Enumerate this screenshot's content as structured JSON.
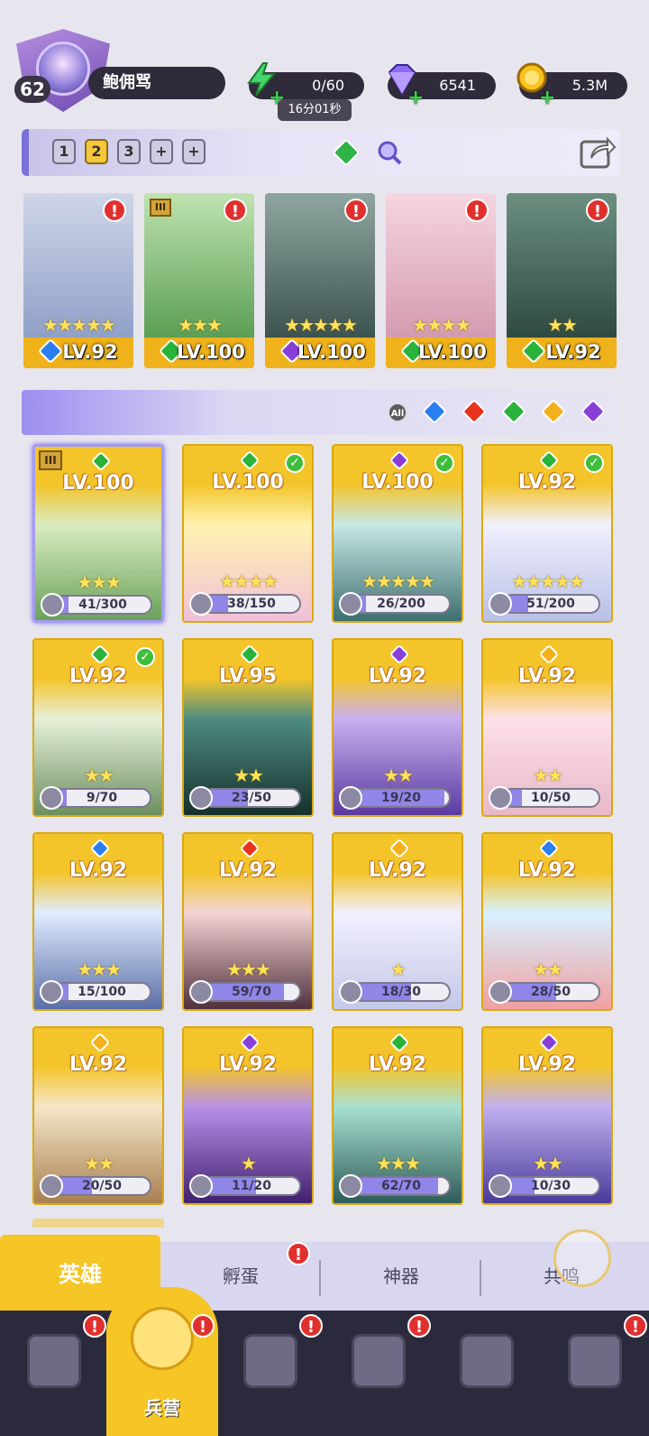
{
  "player": {
    "level": "62",
    "name": "鲍佣骂"
  },
  "resources": {
    "energy": "0/60",
    "energy_timer": "16分01秒",
    "gems": "6541",
    "coins": "5.3M"
  },
  "team": {
    "slots": [
      "1",
      "2",
      "3",
      "+",
      "+"
    ],
    "selected_slot": "2"
  },
  "lineup": [
    {
      "level": "LV.92",
      "stars": "★★★★★",
      "element": "water",
      "alert": "!"
    },
    {
      "level": "LV.100",
      "stars": "★★★",
      "element": "wind",
      "alert": "!",
      "tier": "III"
    },
    {
      "level": "LV.100",
      "stars": "★★★★★",
      "element": "dark",
      "alert": "!"
    },
    {
      "level": "LV.100",
      "stars": "★★★★",
      "element": "wind",
      "alert": "!"
    },
    {
      "level": "LV.92",
      "stars": "★★",
      "element": "wind",
      "alert": "!"
    }
  ],
  "filters": {
    "all_label": "All",
    "elements": [
      "water",
      "fire",
      "wind",
      "light",
      "dark"
    ]
  },
  "element_colors": {
    "water": "#2a7ff0",
    "fire": "#e8341c",
    "wind": "#29b33a",
    "light": "#f4b01c",
    "dark": "#8a3ed8"
  },
  "heroes": [
    {
      "level": "LV.100",
      "element": "wind",
      "stars": "★★★",
      "shards": "41/300",
      "progress": 0.14,
      "checked": false,
      "selected": true,
      "tier": "III"
    },
    {
      "level": "LV.100",
      "element": "wind",
      "stars": "★★★★",
      "shards": "38/150",
      "progress": 0.25,
      "checked": true
    },
    {
      "level": "LV.100",
      "element": "dark",
      "stars": "★★★★★",
      "shards": "26/200",
      "progress": 0.13,
      "checked": true
    },
    {
      "level": "LV.92",
      "element": "wind",
      "stars": "★★★★★",
      "shards": "51/200",
      "progress": 0.26,
      "checked": true
    },
    {
      "level": "LV.92",
      "element": "wind",
      "stars": "★★",
      "shards": "9/70",
      "progress": 0.13,
      "checked": true
    },
    {
      "level": "LV.95",
      "element": "wind",
      "stars": "★★",
      "shards": "23/50",
      "progress": 0.46,
      "checked": false
    },
    {
      "level": "LV.92",
      "element": "dark",
      "stars": "★★",
      "shards": "19/20",
      "progress": 0.95,
      "checked": false
    },
    {
      "level": "LV.92",
      "element": "light",
      "stars": "★★",
      "shards": "10/50",
      "progress": 0.2,
      "checked": false
    },
    {
      "level": "LV.92",
      "element": "water",
      "stars": "★★★",
      "shards": "15/100",
      "progress": 0.15,
      "checked": false
    },
    {
      "level": "LV.92",
      "element": "fire",
      "stars": "★★★",
      "shards": "59/70",
      "progress": 0.84,
      "checked": false
    },
    {
      "level": "LV.92",
      "element": "light",
      "stars": "★",
      "shards": "18/30",
      "progress": 0.6,
      "checked": false
    },
    {
      "level": "LV.92",
      "element": "water",
      "stars": "★★",
      "shards": "28/50",
      "progress": 0.56,
      "checked": false
    },
    {
      "level": "LV.92",
      "element": "light",
      "stars": "★★",
      "shards": "20/50",
      "progress": 0.4,
      "checked": false
    },
    {
      "level": "LV.92",
      "element": "dark",
      "stars": "★",
      "shards": "11/20",
      "progress": 0.55,
      "checked": false
    },
    {
      "level": "LV.92",
      "element": "wind",
      "stars": "★★★",
      "shards": "62/70",
      "progress": 0.89,
      "checked": false
    },
    {
      "level": "LV.92",
      "element": "dark",
      "stars": "★★",
      "shards": "10/30",
      "progress": 0.33,
      "checked": false
    }
  ],
  "sub_tabs": [
    {
      "label": "英雄",
      "active": true
    },
    {
      "label": "孵蛋",
      "alert": "!"
    },
    {
      "label": "神器"
    },
    {
      "label": "共鸣"
    }
  ],
  "nav": [
    {
      "icon": "cards-icon",
      "alert": "!"
    },
    {
      "icon": "barracks-icon",
      "label": "兵营",
      "active": true,
      "alert": "!"
    },
    {
      "icon": "map-icon",
      "alert": "!"
    },
    {
      "icon": "castle-icon",
      "alert": "!"
    },
    {
      "icon": "mushroom-icon"
    },
    {
      "icon": "guild-banner-icon",
      "alert": "!"
    }
  ]
}
